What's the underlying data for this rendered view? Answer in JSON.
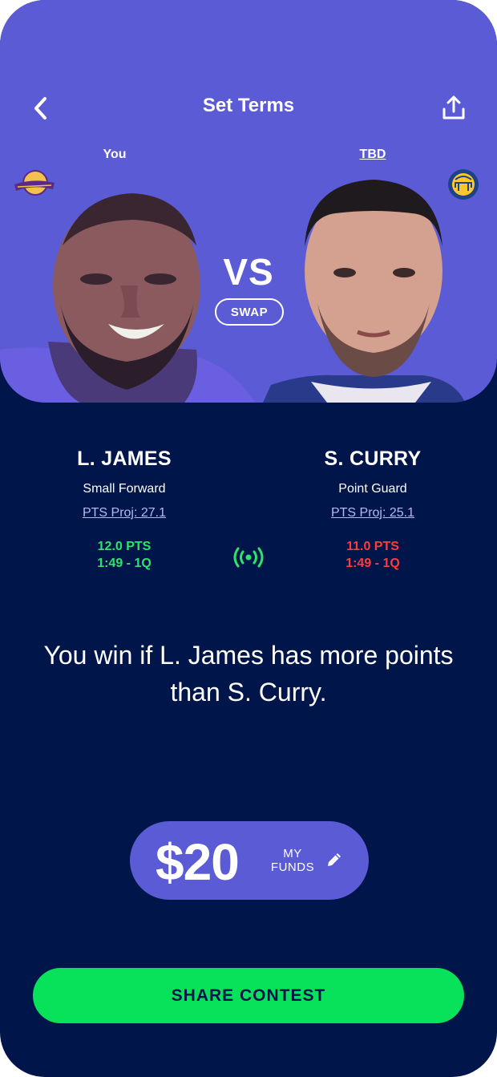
{
  "header": {
    "title": "Set Terms",
    "back_icon": "chevron-left-icon",
    "share_icon": "share-upload-icon"
  },
  "matchup": {
    "left_label": "You",
    "right_label": "TBD",
    "vs": "VS",
    "swap_label": "SWAP"
  },
  "players": {
    "left": {
      "name": "L. JAMES",
      "position": "Small Forward",
      "projection": "PTS Proj: 27.1",
      "points": "12.0 PTS",
      "clock": "1:49 - 1Q",
      "team_logo": "lakers-logo"
    },
    "right": {
      "name": "S. CURRY",
      "position": "Point Guard",
      "projection": "PTS Proj: 25.1",
      "points": "11.0 PTS",
      "clock": "1:49 - 1Q",
      "team_logo": "warriors-logo"
    }
  },
  "live_icon": "live-broadcast-icon",
  "win_condition": "You win if L. James has more points than S. Curry.",
  "funds": {
    "amount": "$20",
    "label_line1": "MY",
    "label_line2": "FUNDS",
    "edit_icon": "pencil-icon"
  },
  "cta": {
    "label": "SHARE CONTEST"
  },
  "colors": {
    "background": "#00154a",
    "accent": "#5b5bd6",
    "cta": "#08e25b",
    "winning": "#2de36b",
    "losing": "#ff3b3b",
    "link": "#b8b7f5"
  }
}
